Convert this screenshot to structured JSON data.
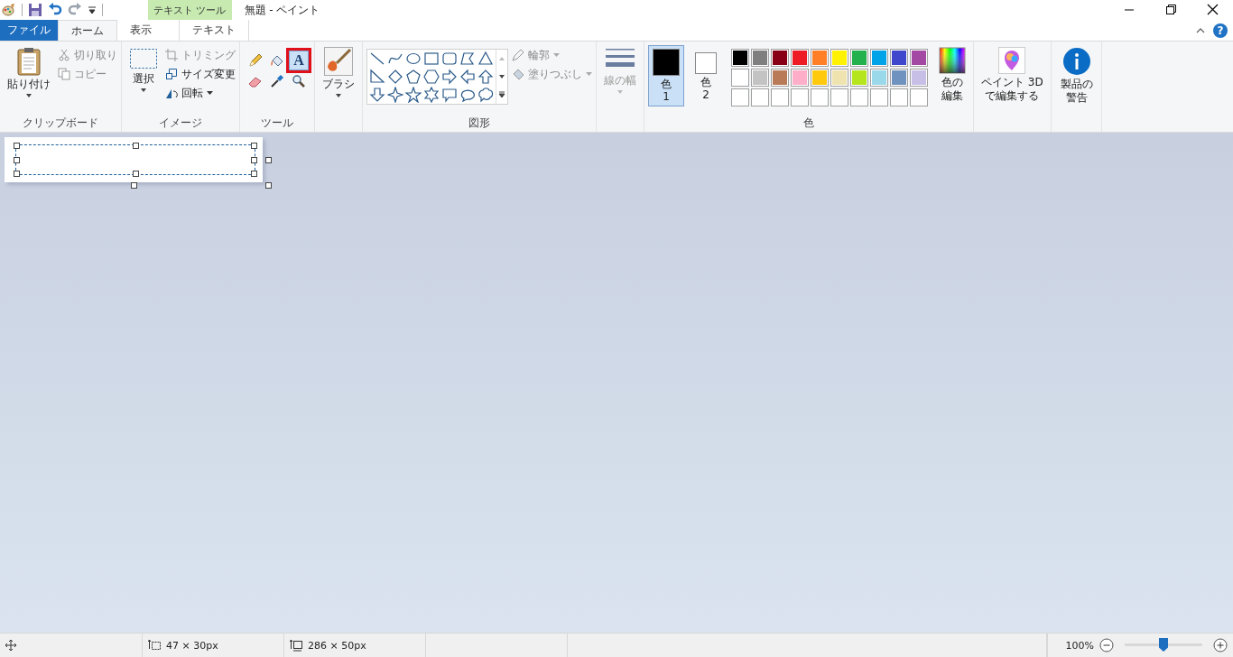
{
  "title_bar": {
    "title": "無題 - ペイント",
    "context_group": "テキスト ツール"
  },
  "tabs": [
    {
      "label": "ファイル",
      "kind": "file",
      "selected": false
    },
    {
      "label": "ホーム",
      "kind": "tab",
      "selected": true
    },
    {
      "label": "表示",
      "kind": "tab",
      "selected": false
    },
    {
      "label": "テキスト",
      "kind": "context",
      "selected": false
    }
  ],
  "clipboard": {
    "label": "クリップボード",
    "paste": "貼り付け",
    "cut": {
      "label": "切り取り",
      "disabled": true
    },
    "copy": {
      "label": "コピー",
      "disabled": true
    }
  },
  "image": {
    "label": "イメージ",
    "select": "選択",
    "crop": {
      "label": "トリミング",
      "disabled": true
    },
    "resize": {
      "label": "サイズ変更",
      "disabled": false
    },
    "rotate": {
      "label": "回転",
      "disabled": false
    }
  },
  "tools": {
    "label": "ツール",
    "items": [
      {
        "kind": "pencil",
        "selected": false,
        "highlighted": false
      },
      {
        "kind": "fill",
        "selected": false,
        "highlighted": false
      },
      {
        "kind": "text",
        "glyph": "A",
        "selected": true,
        "highlighted": true
      },
      {
        "kind": "eraser",
        "selected": false,
        "highlighted": false
      },
      {
        "kind": "picker",
        "selected": false,
        "highlighted": false
      },
      {
        "kind": "magnifier",
        "selected": false,
        "highlighted": false
      }
    ]
  },
  "brush": {
    "label": "ブラシ"
  },
  "shapes": {
    "label": "図形",
    "outline": {
      "label": "輪郭",
      "disabled": true
    },
    "fill": {
      "label": "塗りつぶし",
      "disabled": true
    }
  },
  "line_width": {
    "label": "線の幅",
    "disabled": true
  },
  "colors": {
    "label": "色",
    "color1": {
      "label": "色",
      "number": "1",
      "color": "#000000",
      "selected": true
    },
    "color2": {
      "label": "色",
      "number": "2",
      "color": "#ffffff",
      "selected": false
    },
    "palette": [
      {
        "color": "#000000"
      },
      {
        "color": "#7f7f7f"
      },
      {
        "color": "#880015"
      },
      {
        "color": "#ed1c24"
      },
      {
        "color": "#ff7f27"
      },
      {
        "color": "#fff200"
      },
      {
        "color": "#22b14c"
      },
      {
        "color": "#00a2e8"
      },
      {
        "color": "#3f48cc"
      },
      {
        "color": "#a349a4"
      },
      {
        "color": "#ffffff"
      },
      {
        "color": "#c3c3c3"
      },
      {
        "color": "#b97a57"
      },
      {
        "color": "#ffaec9"
      },
      {
        "color": "#ffc90e"
      },
      {
        "color": "#efe4b0"
      },
      {
        "color": "#b5e61d"
      },
      {
        "color": "#99d9ea"
      },
      {
        "color": "#7092be"
      },
      {
        "color": "#c8bfe7"
      },
      {
        "kind": "empty"
      },
      {
        "kind": "empty"
      },
      {
        "kind": "empty"
      },
      {
        "kind": "empty"
      },
      {
        "kind": "empty"
      },
      {
        "kind": "empty"
      },
      {
        "kind": "empty"
      },
      {
        "kind": "empty"
      },
      {
        "kind": "empty"
      },
      {
        "kind": "empty"
      }
    ],
    "edit_colors": "色の編集"
  },
  "paint3d": "ペイント 3D\nで編集する",
  "warning": "製品の警告",
  "help": "?",
  "status_bar": {
    "selection_size": "47 × 30px",
    "canvas_size": "286 × 50px",
    "zoom": "100%",
    "zoom_level": {
      "level": 0.5
    }
  }
}
